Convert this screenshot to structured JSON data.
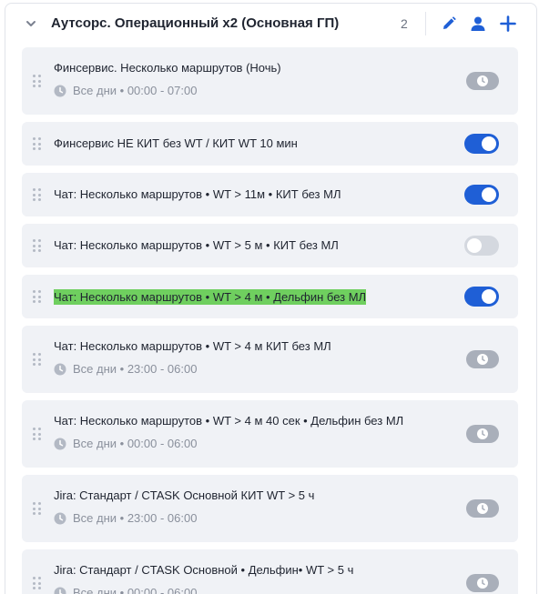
{
  "group": {
    "title": "Аутсорс. Операционный x2 (Основная ГП)",
    "count": "2",
    "icons": {
      "collapse": "chevron-down-icon",
      "edit": "pencil-icon",
      "user": "user-icon",
      "add": "plus-icon"
    },
    "accent": "#1f5fd6"
  },
  "items": [
    {
      "title": "Финсервис. Несколько маршрутов (Ночь)",
      "schedule": "Все дни • 00:00 - 07:00",
      "state": "scheduled"
    },
    {
      "title": "Финсервис НЕ КИТ без WT / КИТ WT 10 мин",
      "state": "on"
    },
    {
      "title": "Чат: Несколько маршрутов • WT > 11м • КИТ без МЛ",
      "state": "on"
    },
    {
      "title": "Чат: Несколько маршрутов • WT > 5 м • КИТ без МЛ",
      "state": "off"
    },
    {
      "title": "Чат: Несколько маршрутов • WT > 4 м • Дельфин без МЛ",
      "state": "on",
      "highlighted": true
    },
    {
      "title": "Чат: Несколько маршрутов • WT > 4 м КИТ без МЛ",
      "schedule": "Все дни • 23:00 - 06:00",
      "state": "scheduled"
    },
    {
      "title": "Чат: Несколько маршрутов • WT > 4 м 40 сек • Дельфин без МЛ",
      "schedule": "Все дни • 00:00 - 06:00",
      "state": "scheduled"
    },
    {
      "title": "Jira: Стандарт / CTASK Основной КИТ WT > 5 ч",
      "schedule": "Все дни • 23:00 - 06:00",
      "state": "scheduled"
    },
    {
      "title": "Jira: Стандарт / CTASK Основной • Дельфин• WT > 5 ч",
      "schedule": "Все дни • 00:00 - 06:00",
      "state": "scheduled"
    }
  ]
}
